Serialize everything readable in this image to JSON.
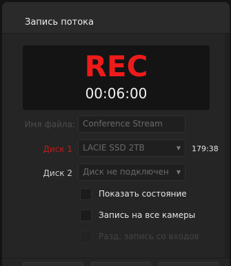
{
  "panel": {
    "title": "Запись потока"
  },
  "recorder": {
    "status": "REC",
    "timecode": "00:06:00"
  },
  "filename": {
    "label": "Имя файла:",
    "value": "Conference Stream"
  },
  "disk1": {
    "label": "Диск 1",
    "value": "LACIE SSD 2TB",
    "remaining": "179:38"
  },
  "disk2": {
    "label": "Диск 2",
    "value": "Диск не подключен"
  },
  "options": [
    {
      "label": "Показать состояние",
      "enabled": true
    },
    {
      "label": "Запись на все камеры",
      "enabled": true
    },
    {
      "label": "Разд. запись со входов",
      "enabled": false
    }
  ],
  "colors": {
    "rec_red": "#ee1b1b",
    "disk1_label_red": "#c41a1a",
    "text": "#e6e6e6",
    "muted": "#4a4a4a"
  },
  "icons": {
    "dropdown": "chevron-down-icon"
  }
}
